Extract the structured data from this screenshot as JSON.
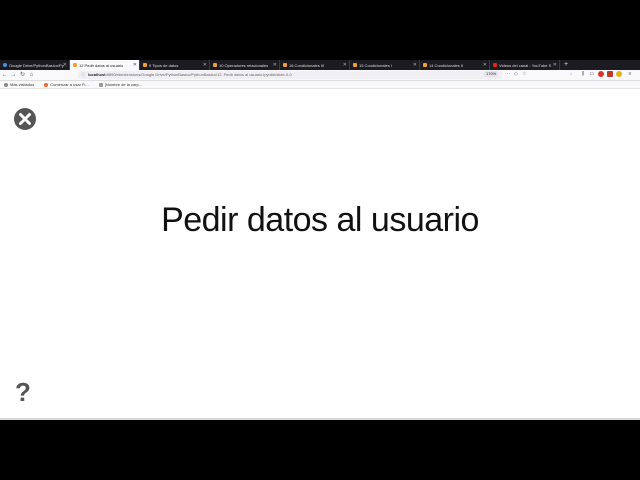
{
  "browser": {
    "tabs": [
      {
        "label": "Google Drive/PythonBasico/Py",
        "icon": "page-icon",
        "active": false
      },
      {
        "label": "12 Pedir datos al usuario",
        "icon": "jupyter-icon",
        "active": true
      },
      {
        "label": "9 Tipos de datos",
        "icon": "jupyter-icon",
        "active": false
      },
      {
        "label": "10 Operadores relacionales",
        "icon": "jupyter-icon",
        "active": false
      },
      {
        "label": "16 Condicionales III",
        "icon": "jupyter-icon",
        "active": false
      },
      {
        "label": "15 Condicionales I",
        "icon": "jupyter-icon",
        "active": false
      },
      {
        "label": "14 Condicionales II",
        "icon": "jupyter-icon",
        "active": false
      },
      {
        "label": "Videos del canal - YouTube S",
        "icon": "youtube-icon",
        "active": false
      }
    ],
    "new_tab": "+",
    "url_host": "localhost",
    "url_rest": ":8890/nbextensions/Google Drive/PythonBasico/PythonBasico/12. Pedir datos al usuario.ipynb#/slide-0-0",
    "zoom": "170%",
    "bookmarks": [
      {
        "label": "Más visitados",
        "icon": "gear-icon"
      },
      {
        "label": "Comenzar a usar Fi...",
        "icon": "firefox-icon"
      },
      {
        "label": "[Nombre de la carp...",
        "icon": "folder-icon"
      }
    ]
  },
  "slide": {
    "title": "Pedir datos al usuario",
    "help_label": "?"
  },
  "colors": {
    "tabbar_bg": "#1c1b22",
    "page_bg": "#ffffff",
    "close_circle": "#555555"
  }
}
